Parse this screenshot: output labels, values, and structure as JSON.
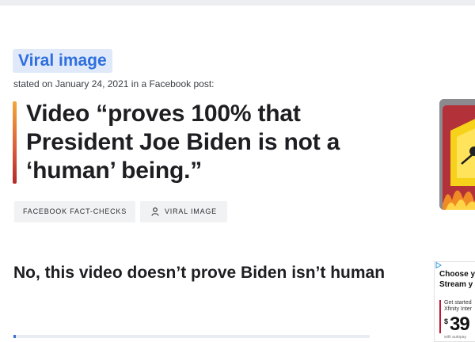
{
  "claim": {
    "speaker": "Viral image",
    "stated_on": "stated on January 24, 2021 in a Facebook post:",
    "quote": "Video “proves 100% that President Joe Biden is not a ‘human’ being.”",
    "tags": [
      {
        "label": "FACEBOOK FACT-CHECKS"
      },
      {
        "label": "VIRAL IMAGE",
        "icon": "person-icon"
      }
    ]
  },
  "article": {
    "headline": "No, this video doesn’t prove Biden isn’t human"
  },
  "ad": {
    "line1": "Choose y",
    "line2": "Stream y",
    "small1": "Get started",
    "small2": "Xfinity Inter",
    "price_symbol": "$",
    "price": "39",
    "fine": "with autopay"
  },
  "colors": {
    "speaker_text": "#2f6fde",
    "speaker_bg": "#dfe9f9",
    "accent_top": "#f2a83a",
    "accent_bottom": "#b22a2a",
    "ad_accent": "#c0162f"
  }
}
